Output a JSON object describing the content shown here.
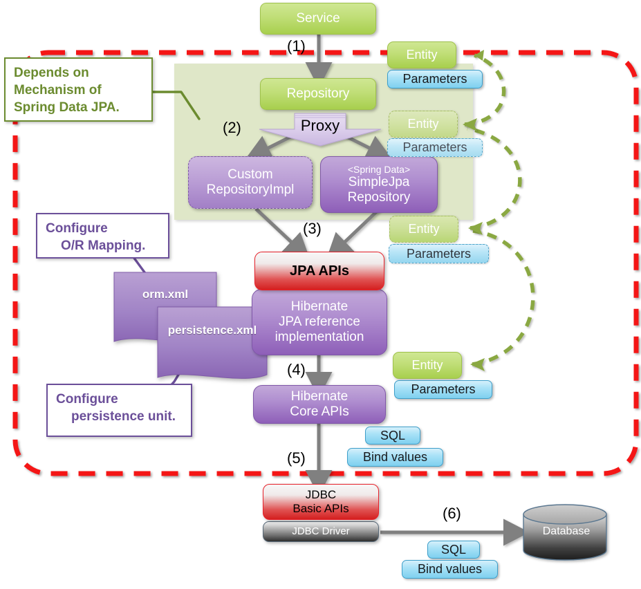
{
  "diagram": {
    "title": "Spring Data JPA architecture flow",
    "colors": {
      "green": "#b9d95f",
      "blue": "#a9e2f7",
      "purple": "#8e5fb8",
      "red": "#e8212a",
      "grey": "#6e6e6e",
      "note_green": "#6b8b2f",
      "note_purple": "#6b4f99",
      "region": "#dfe7c8",
      "arrow": "#808080",
      "dashed_green": "#8aa843"
    }
  },
  "nodes": {
    "service": "Service",
    "repository": "Repository",
    "proxy": "Proxy",
    "custom_repository_impl_line1": "Custom",
    "custom_repository_impl_line2": "RepositoryImpl",
    "simple_jpa_stereotype": "<Spring Data>",
    "simple_jpa_line1": "SimpleJpa",
    "simple_jpa_line2": "Repository",
    "jpa_apis": "JPA APIs",
    "hibernate_jpa_line1": "Hibernate",
    "hibernate_jpa_line2": "JPA reference",
    "hibernate_jpa_line3": "implementation",
    "hibernate_core_line1": "Hibernate",
    "hibernate_core_line2": "Core APIs",
    "jdbc_basic_line1": "JDBC",
    "jdbc_basic_line2": "Basic APIs",
    "jdbc_driver": "JDBC Driver",
    "database": "Database",
    "orm_xml": "orm.xml",
    "persistence_xml": "persistence.xml"
  },
  "entities": [
    {
      "entity": "Entity",
      "parameters": "Parameters"
    },
    {
      "entity": "Entity",
      "parameters": "Parameters"
    },
    {
      "entity": "Entity",
      "parameters": "Parameters"
    },
    {
      "entity": "Entity",
      "parameters": "Parameters"
    }
  ],
  "sql_tags": [
    {
      "sql": "SQL",
      "bind": "Bind values"
    },
    {
      "sql": "SQL",
      "bind": "Bind values"
    }
  ],
  "steps": {
    "s1": "(1)",
    "s2": "(2)",
    "s3": "(3)",
    "s4": "(4)",
    "s5": "(5)",
    "s6": "(6)"
  },
  "notes": {
    "depends": {
      "line1": "Depends on",
      "line2": "Mechanism of",
      "line3": "Spring Data JPA."
    },
    "or_mapping": {
      "line1": "Configure",
      "line2": "O/R Mapping."
    },
    "persistence_unit": {
      "line1": "Configure",
      "line2": "persistence unit."
    }
  }
}
